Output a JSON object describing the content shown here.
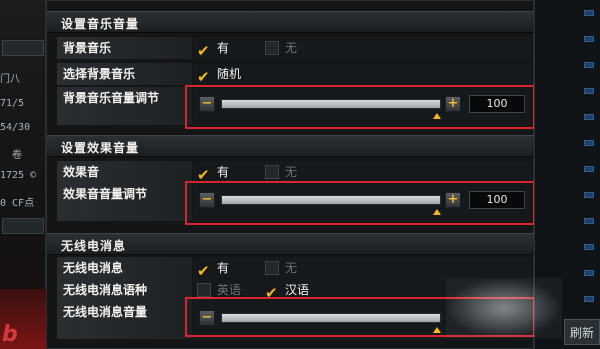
{
  "left_strip": {
    "lines": [
      "门八",
      "71/5",
      "54/30",
      "卷",
      "1725 ©",
      "0 CF点"
    ],
    "red_text": "b"
  },
  "right_strip": {
    "refresh_label": "刷新"
  },
  "music_section": {
    "title": "设置音乐音量",
    "rows": [
      {
        "label": "背景音乐",
        "opt1": "有",
        "opt2": "无"
      },
      {
        "label": "选择背景音乐",
        "opt1": "随机"
      }
    ],
    "slider": {
      "label": "背景音乐音量调节",
      "value": "100",
      "level": 1.0
    }
  },
  "effect_section": {
    "title": "设置效果音量",
    "rows": [
      {
        "label": "效果音",
        "opt1": "有",
        "opt2": "无"
      }
    ],
    "slider": {
      "label": "效果音音量调节",
      "value": "100",
      "level": 1.0
    }
  },
  "radio_section": {
    "title": "无线电消息",
    "rows": [
      {
        "label": "无线电消息",
        "opt1": "有",
        "opt2": "无"
      },
      {
        "label": "无线电消息语种",
        "opt1": "英语",
        "opt2": "汉语"
      }
    ],
    "slider": {
      "label": "无线电消息音量",
      "level": 1.0
    }
  },
  "colors": {
    "accent": "#f3b621",
    "highlight": "#d8262c"
  }
}
